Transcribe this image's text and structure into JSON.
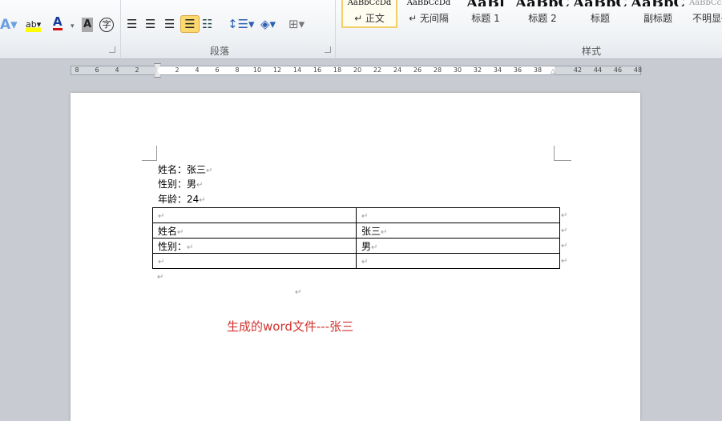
{
  "ribbon": {
    "groups": {
      "paragraph": "段落",
      "styles": "样式"
    },
    "styles": [
      {
        "preview": "AaBbCcDd",
        "label": "↵ 正文",
        "selected": true
      },
      {
        "preview": "AaBbCcDd",
        "label": "↵ 无间隔"
      },
      {
        "preview": "AaBl",
        "label": "标题 1"
      },
      {
        "preview": "AaBbC",
        "label": "标题 2"
      },
      {
        "preview": "AaBbC",
        "label": "标题"
      },
      {
        "preview": "AaBbC",
        "label": "副标题"
      },
      {
        "preview": "AaBbCcD",
        "label": "不明显强调"
      }
    ],
    "accent": "#f7d36b"
  },
  "ruler": {
    "ticks": [
      "8",
      "6",
      "4",
      "2",
      "2",
      "4",
      "6",
      "8",
      "10",
      "12",
      "14",
      "16",
      "18",
      "20",
      "22",
      "24",
      "26",
      "28",
      "30",
      "32",
      "34",
      "36",
      "38",
      "42",
      "44",
      "46",
      "48"
    ]
  },
  "document": {
    "lines": [
      "姓名：张三",
      "性别：男",
      "年龄：24"
    ],
    "paragraph_mark": "↵",
    "table": [
      [
        "",
        ""
      ],
      [
        "姓名",
        "张三"
      ],
      [
        "性别：",
        "男"
      ],
      [
        "",
        ""
      ]
    ],
    "red_text": "生成的word文件---张三",
    "red_color": "#d2322d"
  }
}
